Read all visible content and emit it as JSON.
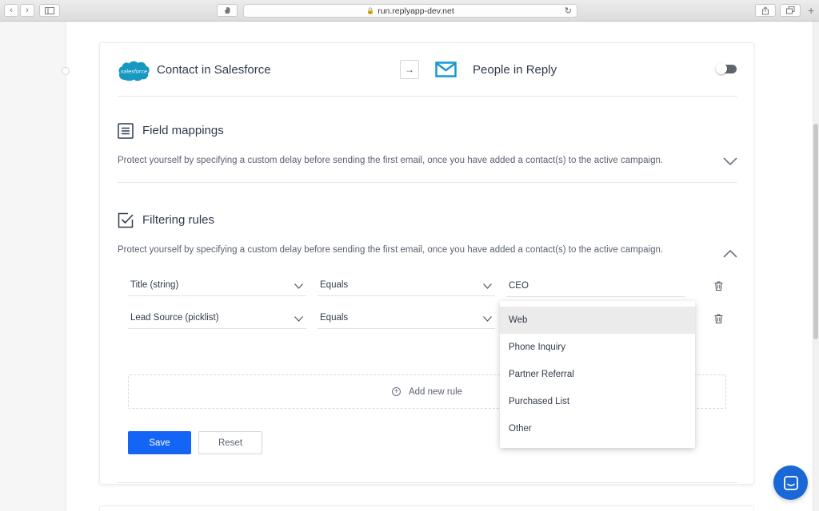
{
  "browser": {
    "url": "run.replyapp-dev.net"
  },
  "integration": {
    "source_title": "Contact in Salesforce",
    "source_logo_text": "salesforce",
    "target_title": "People in Reply"
  },
  "sections": {
    "field_mappings": {
      "title": "Field mappings",
      "description": "Protect yourself by specifying a custom delay before sending the first email, once you have added a contact(s) to the active campaign."
    },
    "filtering_rules": {
      "title": "Filtering rules",
      "description": "Protect yourself by specifying a custom delay before sending the first email, once you have added a contact(s) to the active campaign."
    }
  },
  "rules": [
    {
      "field": "Title (string)",
      "operator": "Equals",
      "value": "CEO"
    },
    {
      "field": "Lead Source (picklist)",
      "operator": "Equals",
      "value": ""
    }
  ],
  "add_rule_label": "Add new rule",
  "buttons": {
    "save": "Save",
    "reset": "Reset"
  },
  "dropdown": {
    "selected": "Web",
    "options": [
      "Web",
      "Phone Inquiry",
      "Partner Referral",
      "Purchased List",
      "Other"
    ]
  },
  "colors": {
    "primary": "#1464f6",
    "salesforce": "#1798c1",
    "chat": "#1a67d6"
  }
}
